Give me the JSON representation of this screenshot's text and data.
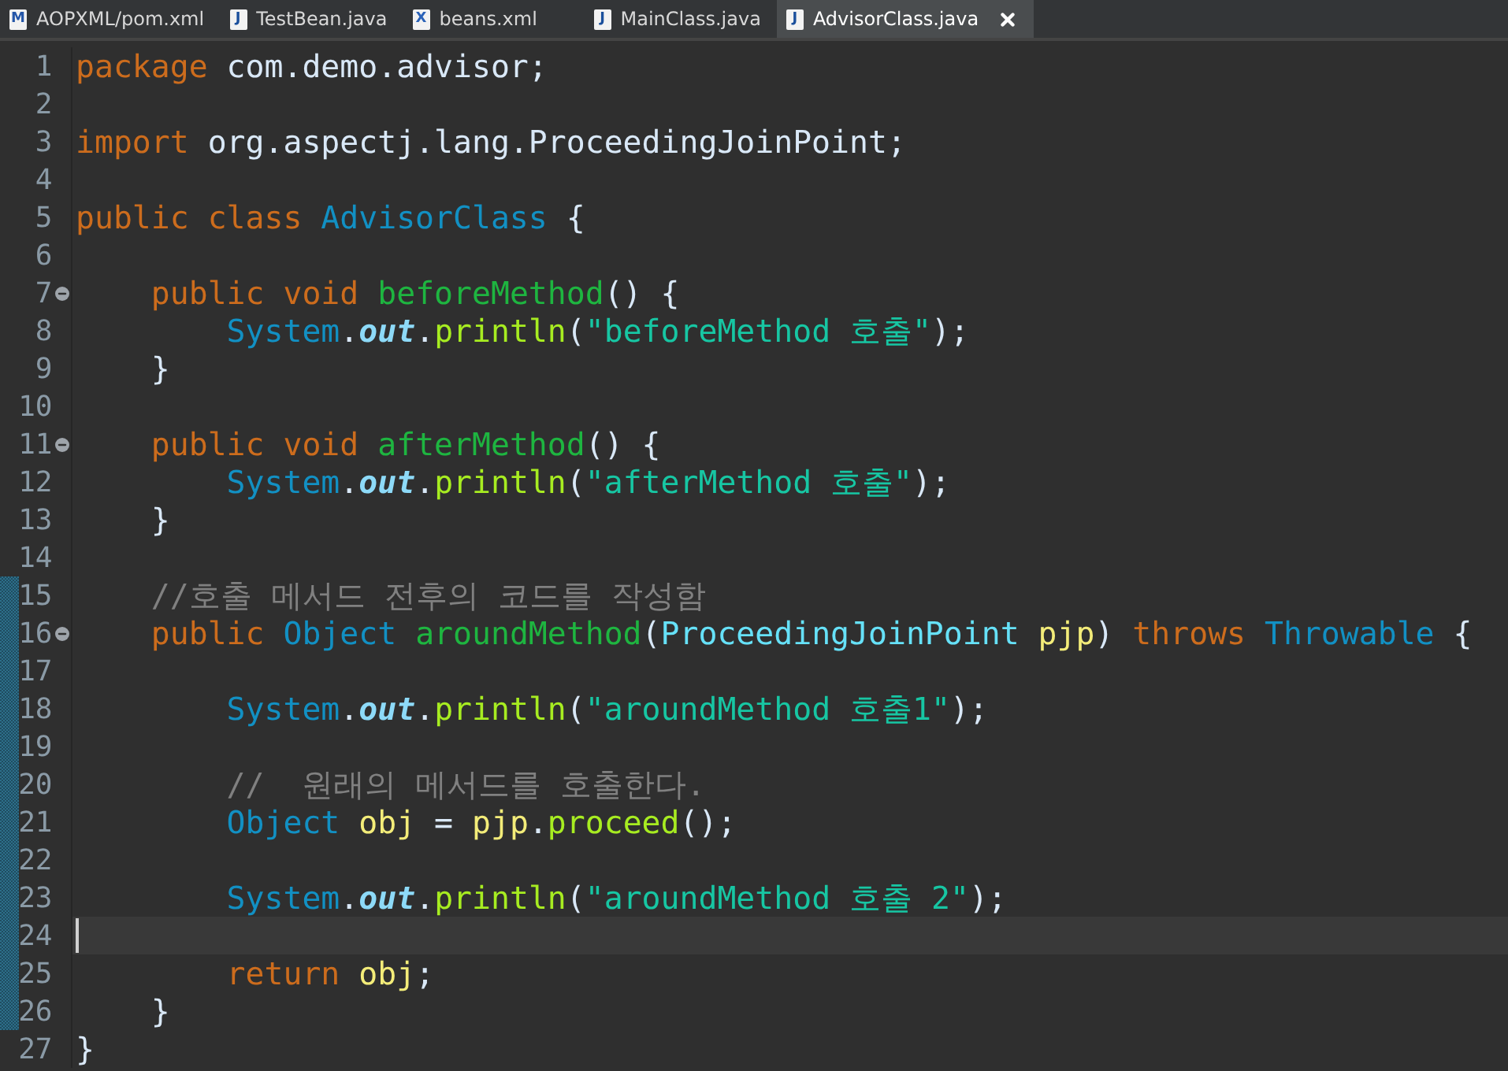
{
  "tabs": [
    {
      "label": "AOPXML/pom.xml",
      "icon": "M",
      "kind": "maven",
      "selected": false
    },
    {
      "label": "TestBean.java",
      "icon": "J",
      "kind": "java",
      "selected": false
    },
    {
      "label": "beans.xml",
      "icon": "X",
      "kind": "xml",
      "selected": false
    },
    {
      "label": "MainClass.java",
      "icon": "J",
      "kind": "java",
      "selected": false
    },
    {
      "label": "AdvisorClass.java",
      "icon": "J",
      "kind": "java",
      "selected": true
    }
  ],
  "lines": [
    {
      "number": "1",
      "tokens": [
        {
          "kind": "keyword",
          "text": "package"
        },
        {
          "kind": "plain",
          "text": " com.demo.advisor;"
        }
      ]
    },
    {
      "number": "2"
    },
    {
      "number": "3",
      "tokens": [
        {
          "kind": "keyword",
          "text": "import"
        },
        {
          "kind": "plain",
          "text": " org.aspectj.lang.ProceedingJoinPoint;"
        }
      ]
    },
    {
      "number": "4"
    },
    {
      "number": "5",
      "tokens": [
        {
          "kind": "keyword",
          "text": "public class"
        },
        {
          "kind": "type",
          "text": " AdvisorClass"
        },
        {
          "kind": "plain",
          "text": " {"
        }
      ]
    },
    {
      "number": "6"
    },
    {
      "number": "7",
      "foldable": true,
      "tokens": [
        {
          "kind": "keyword",
          "text": "    public void"
        },
        {
          "kind": "method",
          "text": " beforeMethod"
        },
        {
          "kind": "plain",
          "text": "() {"
        }
      ]
    },
    {
      "number": "8",
      "tokens": [
        {
          "kind": "type",
          "text": "        System"
        },
        {
          "kind": "plain",
          "text": "."
        },
        {
          "kind": "field",
          "text": "out"
        },
        {
          "kind": "plain",
          "text": "."
        },
        {
          "kind": "call",
          "text": "println"
        },
        {
          "kind": "plain",
          "text": "("
        },
        {
          "kind": "string",
          "text": "\"beforeMethod 호출\""
        },
        {
          "kind": "plain",
          "text": ");"
        }
      ]
    },
    {
      "number": "9",
      "tokens": [
        {
          "kind": "plain",
          "text": "    }"
        }
      ]
    },
    {
      "number": "10"
    },
    {
      "number": "11",
      "foldable": true,
      "tokens": [
        {
          "kind": "keyword",
          "text": "    public void"
        },
        {
          "kind": "method",
          "text": " afterMethod"
        },
        {
          "kind": "plain",
          "text": "() {"
        }
      ]
    },
    {
      "number": "12",
      "tokens": [
        {
          "kind": "type",
          "text": "        System"
        },
        {
          "kind": "plain",
          "text": "."
        },
        {
          "kind": "field",
          "text": "out"
        },
        {
          "kind": "plain",
          "text": "."
        },
        {
          "kind": "call",
          "text": "println"
        },
        {
          "kind": "plain",
          "text": "("
        },
        {
          "kind": "string",
          "text": "\"afterMethod 호출\""
        },
        {
          "kind": "plain",
          "text": ");"
        }
      ]
    },
    {
      "number": "13",
      "tokens": [
        {
          "kind": "plain",
          "text": "    }"
        }
      ]
    },
    {
      "number": "14"
    },
    {
      "number": "15",
      "modified": true,
      "tokens": [
        {
          "kind": "comment",
          "text": "    //호출 메서드 전후의 코드를 작성함"
        }
      ]
    },
    {
      "number": "16",
      "modified": true,
      "foldable": true,
      "tokens": [
        {
          "kind": "keyword",
          "text": "    public"
        },
        {
          "kind": "type",
          "text": " Object"
        },
        {
          "kind": "method",
          "text": " aroundMethod"
        },
        {
          "kind": "plain",
          "text": "("
        },
        {
          "kind": "param",
          "text": "ProceedingJoinPoint"
        },
        {
          "kind": "variable",
          "text": " pjp"
        },
        {
          "kind": "plain",
          "text": ")"
        },
        {
          "kind": "keyword",
          "text": " throws"
        },
        {
          "kind": "type",
          "text": " Throwable"
        },
        {
          "kind": "plain",
          "text": " {"
        }
      ]
    },
    {
      "number": "17",
      "modified": true
    },
    {
      "number": "18",
      "modified": true,
      "tokens": [
        {
          "kind": "type",
          "text": "        System"
        },
        {
          "kind": "plain",
          "text": "."
        },
        {
          "kind": "field",
          "text": "out"
        },
        {
          "kind": "plain",
          "text": "."
        },
        {
          "kind": "call",
          "text": "println"
        },
        {
          "kind": "plain",
          "text": "("
        },
        {
          "kind": "string",
          "text": "\"aroundMethod 호출1\""
        },
        {
          "kind": "plain",
          "text": ");"
        }
      ]
    },
    {
      "number": "19",
      "modified": true
    },
    {
      "number": "20",
      "modified": true,
      "tokens": [
        {
          "kind": "comment",
          "text": "        //  원래의 메서드를 호출한다."
        }
      ]
    },
    {
      "number": "21",
      "modified": true,
      "tokens": [
        {
          "kind": "type",
          "text": "        Object"
        },
        {
          "kind": "variable",
          "text": " obj"
        },
        {
          "kind": "plain",
          "text": " = "
        },
        {
          "kind": "variable",
          "text": "pjp"
        },
        {
          "kind": "plain",
          "text": "."
        },
        {
          "kind": "call",
          "text": "proceed"
        },
        {
          "kind": "plain",
          "text": "();"
        }
      ]
    },
    {
      "number": "22",
      "modified": true
    },
    {
      "number": "23",
      "modified": true,
      "tokens": [
        {
          "kind": "type",
          "text": "        System"
        },
        {
          "kind": "plain",
          "text": "."
        },
        {
          "kind": "field",
          "text": "out"
        },
        {
          "kind": "plain",
          "text": "."
        },
        {
          "kind": "call",
          "text": "println"
        },
        {
          "kind": "plain",
          "text": "("
        },
        {
          "kind": "string",
          "text": "\"aroundMethod 호출 2\""
        },
        {
          "kind": "plain",
          "text": ");"
        }
      ]
    },
    {
      "number": "24",
      "modified": true,
      "current": true
    },
    {
      "number": "25",
      "modified": true,
      "tokens": [
        {
          "kind": "keyword",
          "text": "        return"
        },
        {
          "kind": "variable",
          "text": " obj"
        },
        {
          "kind": "plain",
          "text": ";"
        }
      ]
    },
    {
      "number": "26",
      "modified": true,
      "tokens": [
        {
          "kind": "plain",
          "text": "    }"
        }
      ]
    },
    {
      "number": "27",
      "tokens": [
        {
          "kind": "plain",
          "text": "}"
        }
      ]
    }
  ]
}
